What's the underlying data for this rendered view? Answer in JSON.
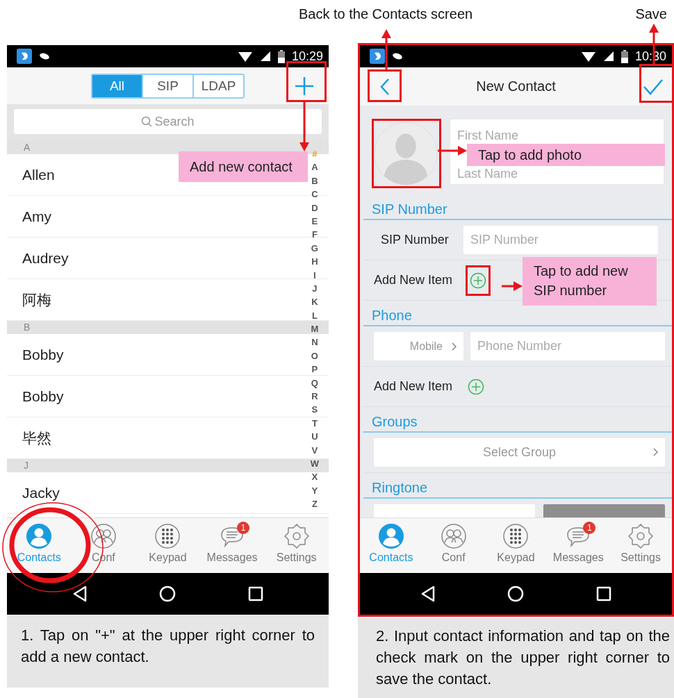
{
  "annotations": {
    "back_label": "Back to the Contacts screen",
    "save_label": "Save"
  },
  "contacts_screen": {
    "status_time": "10:29",
    "filters": [
      {
        "label": "All",
        "selected": true
      },
      {
        "label": "SIP",
        "selected": false
      },
      {
        "label": "LDAP",
        "selected": false
      }
    ],
    "add_button": {
      "highlighted": true,
      "callout": "Add new contact"
    },
    "search": {
      "placeholder": "Search"
    },
    "sections": [
      {
        "letter": "A",
        "contacts": [
          "Allen",
          "Amy",
          "Audrey",
          "阿梅"
        ]
      },
      {
        "letter": "B",
        "contacts": [
          "Bobby",
          "Bobby",
          "毕然"
        ]
      },
      {
        "letter": "J",
        "contacts": [
          "Jacky"
        ]
      }
    ],
    "index": [
      {
        "letter": "#",
        "selected": true
      },
      {
        "letter": "A",
        "selected": false
      },
      {
        "letter": "B",
        "selected": false
      },
      {
        "letter": "C",
        "selected": false
      },
      {
        "letter": "D",
        "selected": false
      },
      {
        "letter": "E",
        "selected": false
      },
      {
        "letter": "F",
        "selected": false
      },
      {
        "letter": "G",
        "selected": false
      },
      {
        "letter": "H",
        "selected": false
      },
      {
        "letter": "I",
        "selected": false
      },
      {
        "letter": "J",
        "selected": false
      },
      {
        "letter": "K",
        "selected": false
      },
      {
        "letter": "L",
        "selected": false
      },
      {
        "letter": "M",
        "selected": false
      },
      {
        "letter": "N",
        "selected": false
      },
      {
        "letter": "O",
        "selected": false
      },
      {
        "letter": "P",
        "selected": false
      },
      {
        "letter": "Q",
        "selected": false
      },
      {
        "letter": "R",
        "selected": false
      },
      {
        "letter": "S",
        "selected": false
      },
      {
        "letter": "T",
        "selected": false
      },
      {
        "letter": "U",
        "selected": false
      },
      {
        "letter": "V",
        "selected": false
      },
      {
        "letter": "W",
        "selected": false
      },
      {
        "letter": "X",
        "selected": false
      },
      {
        "letter": "Y",
        "selected": false
      },
      {
        "letter": "Z",
        "selected": false
      }
    ],
    "tabs": [
      {
        "label": "Contacts",
        "selected": true,
        "highlighted": true
      },
      {
        "label": "Conf",
        "selected": false,
        "highlighted": false
      },
      {
        "label": "Keypad",
        "selected": false,
        "highlighted": false
      },
      {
        "label": "Messages",
        "selected": false,
        "highlighted": false,
        "badge": "1"
      },
      {
        "label": "Settings",
        "selected": false,
        "highlighted": false
      }
    ],
    "caption": "1. Tap on \"+\" at the upper right corner to add a new contact."
  },
  "new_contact_screen": {
    "status_time": "10:30",
    "title": "New Contact",
    "back_button": {
      "highlighted": true
    },
    "save_button": {
      "highlighted": true
    },
    "photo": {
      "highlighted": true,
      "callout": "Tap to add photo"
    },
    "name_fields": [
      {
        "placeholder": "First Name"
      },
      {
        "placeholder": "Last Name"
      }
    ],
    "sections": [
      {
        "title": "SIP Number",
        "rows": [
          {
            "kind": "labeled_field",
            "label": "SIP Number",
            "placeholder": "SIP Number"
          },
          {
            "kind": "add_item",
            "label": "Add New Item",
            "highlighted": true,
            "callout": "Tap to add new SIP number"
          }
        ]
      },
      {
        "title": "Phone",
        "rows": [
          {
            "kind": "typed_field",
            "type_label": "Mobile",
            "placeholder": "Phone Number"
          },
          {
            "kind": "add_item",
            "label": "Add New Item",
            "highlighted": false
          }
        ]
      },
      {
        "title": "Groups",
        "rows": [
          {
            "kind": "select",
            "placeholder": "Select Group"
          }
        ]
      },
      {
        "title": "Ringtone",
        "rows": [
          {
            "kind": "ringtone"
          }
        ]
      }
    ],
    "tabs": [
      {
        "label": "Contacts",
        "selected": true
      },
      {
        "label": "Conf",
        "selected": false
      },
      {
        "label": "Keypad",
        "selected": false
      },
      {
        "label": "Messages",
        "selected": false,
        "badge": "1"
      },
      {
        "label": "Settings",
        "selected": false
      }
    ],
    "caption": "2. Input contact information and tap on the check mark on the upper right corner to save the contact."
  }
}
